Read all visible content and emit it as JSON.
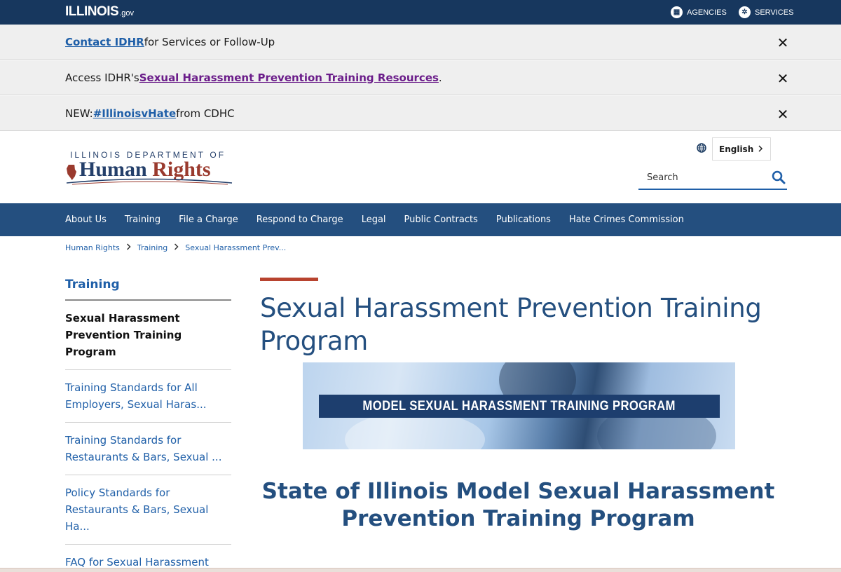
{
  "topbar": {
    "brand": "ILLINOIS",
    "brand_suffix": ".gov",
    "agencies_label": "AGENCIES",
    "services_label": "SERVICES"
  },
  "alerts": [
    {
      "before": "",
      "link": "Contact IDHR",
      "after": " for Services or Follow-Up",
      "link_color": "#1f5fa8"
    },
    {
      "before": "Access IDHR's ",
      "link": "Sexual Harassment Prevention Training Resources",
      "after": ".",
      "link_color": "#6b1d8a"
    },
    {
      "before": "NEW: ",
      "link": "#IllinoisvHate",
      "after": " from CDHC",
      "link_color": "#1f5fa8"
    }
  ],
  "close_glyph": "✕",
  "logo": {
    "top_line": "ILLINOIS DEPARTMENT OF",
    "word1": "Human",
    "word2": "Rights"
  },
  "language": {
    "label": "English"
  },
  "search": {
    "placeholder": "Search"
  },
  "nav": {
    "items": [
      "About Us",
      "Training",
      "File a Charge",
      "Respond to Charge",
      "Legal",
      "Public Contracts",
      "Publications",
      "Hate Crimes Commission"
    ]
  },
  "breadcrumb": [
    "Human Rights",
    "Training",
    "Sexual Harassment Prev..."
  ],
  "sidebar": {
    "title": "Training",
    "items": [
      {
        "label": "Sexual Harassment Prevention Training Program",
        "active": true
      },
      {
        "label": "Training Standards for All Employers, Sexual Haras...",
        "active": false
      },
      {
        "label": "Training Standards for Restaurants & Bars, Sexual ...",
        "active": false
      },
      {
        "label": "Policy Standards for Restaurants & Bars, Sexual Ha...",
        "active": false
      },
      {
        "label": "FAQ for Sexual Harassment Prevention Training",
        "active": false
      }
    ]
  },
  "main": {
    "title": "Sexual Harassment Prevention Training Program",
    "banner_text": "MODEL SEXUAL HARASSMENT TRAINING PROGRAM",
    "subtitle": "State of Illinois Model Sexual Harassment Prevention Training Program"
  },
  "colors": {
    "topbar": "#17375e",
    "nav": "#244f7f",
    "link": "#1f5fa8",
    "accent": "#b8432f"
  }
}
